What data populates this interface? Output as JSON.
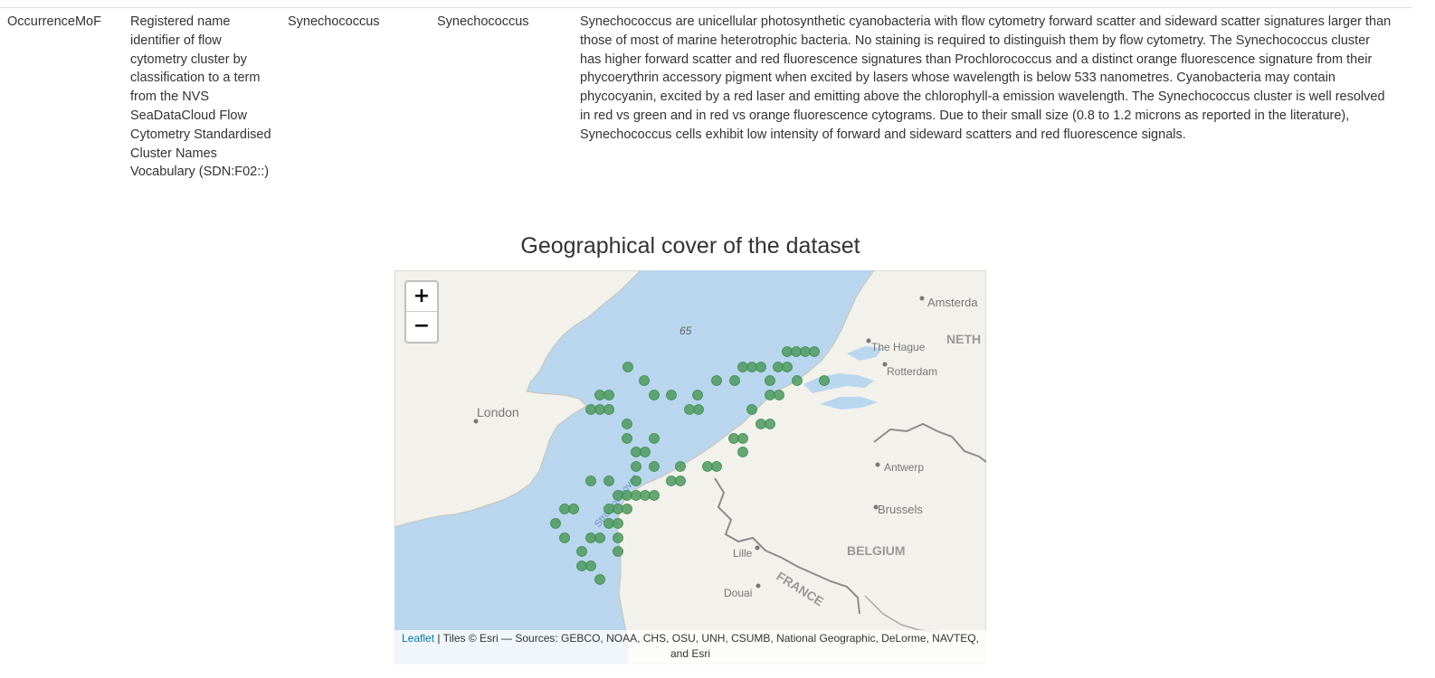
{
  "table_row": {
    "type": "OccurrenceMoF",
    "description": "Registered name identifier of flow cytometry cluster by classification to a term from the NVS SeaDataCloud Flow Cytometry Standardised Cluster Names Vocabulary (SDN:F02::)",
    "value": "Synechococcus",
    "value_alt": "Synechococcus",
    "definition": "Synechococcus are unicellular photosynthetic cyanobacteria with flow cytometry forward scatter and sideward scatter signatures larger than those of most of marine heterotrophic bacteria. No staining is required to distinguish them by flow cytometry. The Synechococcus cluster has higher forward scatter and red fluorescence signatures than Prochlorococcus and a distinct orange fluorescence signature from their phycoerythrin accessory pigment when excited by lasers whose wavelength is below 533 nanometres. Cyanobacteria may contain phycocyanin, excited by a red laser and emitting above the chlorophyll-a emission wavelength. The Synechococcus cluster is well resolved in red vs green and in red vs orange fluorescence cytograms. Due to their small size (0.8 to 1.2 microns as reported in the literature), Synechococcus cells exhibit low intensity of forward and sideward scatters and red fluorescence signals."
  },
  "map": {
    "title": "Geographical cover of the dataset",
    "zoom_in": "+",
    "zoom_out": "−",
    "labels": {
      "amsterdam": "Amsterda",
      "the_hague": "The Hague",
      "rotterdam": "Rotterdam",
      "netherlands": "NETH",
      "london": "London",
      "antwerp": "Antwerp",
      "brussels": "Brussels",
      "belgium": "BELGIUM",
      "lille": "Lille",
      "france": "FRANCE",
      "douai": "Douai",
      "strait": "Strait of Dover",
      "depth": "65"
    },
    "attribution_link": "Leaflet",
    "attribution_text": " | Tiles © Esri — Sources: GEBCO, NOAA, CHS, OSU, UNH, CSUMB, National Geographic, DeLorme, NAVTEQ, and Esri",
    "colors": {
      "sea": "#b9d6ee",
      "land": "#f2f1ec",
      "marker": "#4e9a5e"
    }
  }
}
